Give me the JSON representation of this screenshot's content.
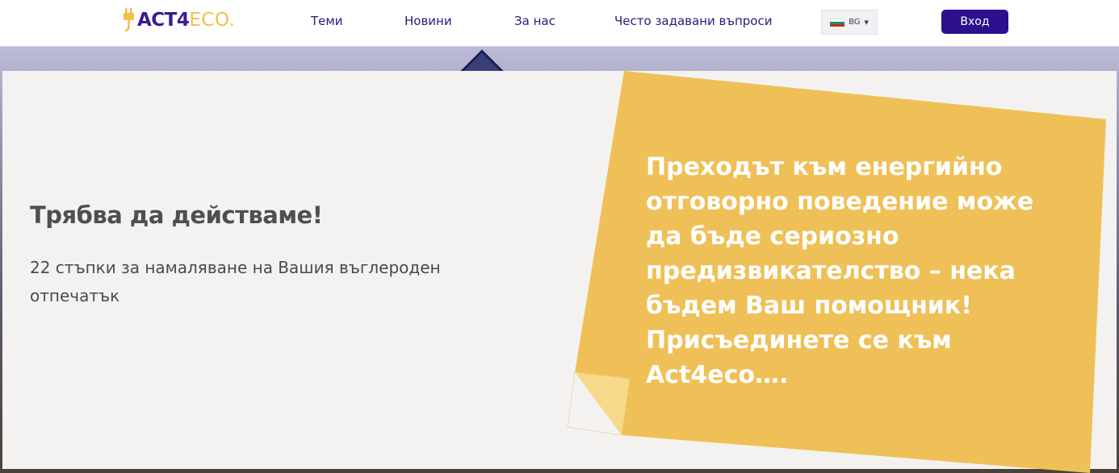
{
  "header": {
    "logo_act": "ACT4",
    "logo_eco": "ECO.",
    "nav": [
      {
        "label": "Теми"
      },
      {
        "label": "Новини"
      },
      {
        "label": "За нас"
      },
      {
        "label": "Често задавани въпроси"
      }
    ],
    "language": {
      "code": "BG",
      "flag_colors": [
        "#ffffff",
        "#00966e",
        "#d62612"
      ]
    },
    "login_label": "Вход"
  },
  "hero": {
    "title": "Трябва да действаме!",
    "subtitle": "22 стъпки за намаляване на Вашия въглероден отпечатък",
    "note_text": "Преходът към енергийно отговорно поведение може да бъде сериозно предизвикателство – нека бъдем Ваш помощник! Присъединете се към Act4eco….",
    "note_color": "#efc057",
    "note_fold_color": "#f6d98a"
  },
  "colors": {
    "brand_purple": "#2c0f8c",
    "accent_yellow": "#f0c04a"
  }
}
